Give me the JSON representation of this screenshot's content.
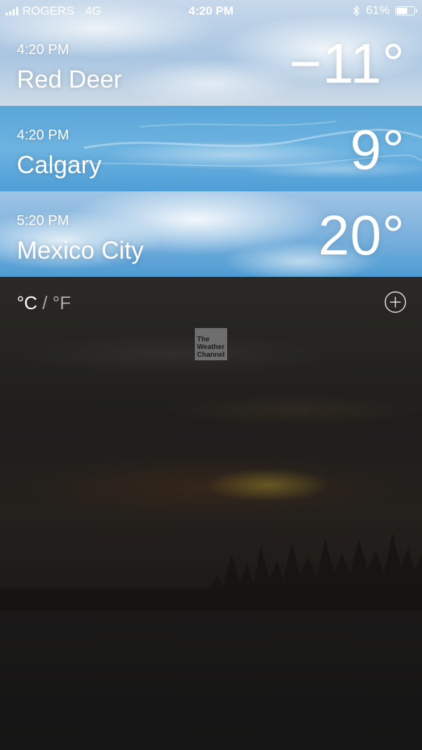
{
  "status_bar": {
    "carrier": "ROGERS",
    "network": "4G",
    "time": "4:20 PM",
    "battery": "61%",
    "battery_level": 0.61
  },
  "cities": [
    {
      "local_time": "4:20 PM",
      "name": "Red Deer",
      "temperature": "−11°"
    },
    {
      "local_time": "4:20 PM",
      "name": "Calgary",
      "temperature": "9°"
    },
    {
      "local_time": "5:20 PM",
      "name": "Mexico City",
      "temperature": "20°"
    }
  ],
  "footer": {
    "unit_celsius": "°C",
    "unit_separator": "/",
    "unit_fahrenheit": "°F",
    "add_icon": "plus-circle-icon",
    "logo_lines": [
      "The",
      "Weather",
      "Channel"
    ]
  },
  "colors": {
    "text": "#ffffff",
    "calgary_sky": "#5aa6d9",
    "background": "#141414"
  }
}
